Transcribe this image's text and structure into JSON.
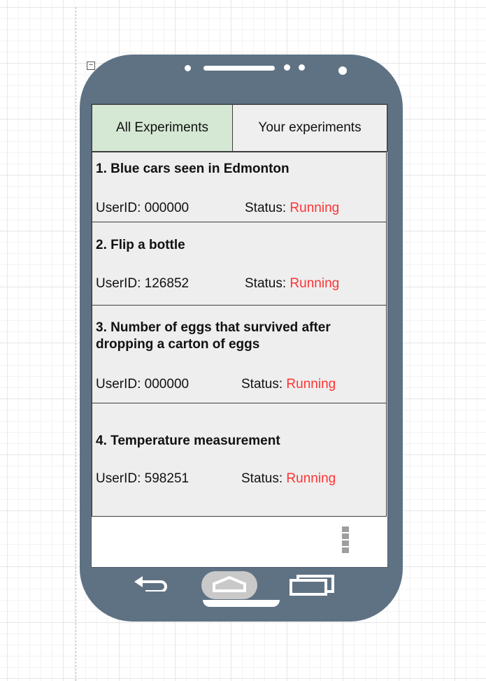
{
  "tabs": {
    "all_experiments": "All Experiments",
    "your_experiments": "Your experiments"
  },
  "experiments": [
    {
      "title": "1. Blue cars seen in Edmonton",
      "user_label": "UserID: 000000",
      "status_label": "Status: ",
      "status_value": "Running"
    },
    {
      "title": "2. Flip a bottle",
      "user_label": "UserID: 126852",
      "status_label": "Status: ",
      "status_value": "Running"
    },
    {
      "title": "3. Number of eggs that survived after dropping a carton of eggs",
      "user_label": "UserID: 000000",
      "status_label": "Status: ",
      "status_value": "Running"
    },
    {
      "title": "4. Temperature measurement",
      "user_label": "UserID: 598251",
      "status_label": "Status: ",
      "status_value": "Running"
    }
  ],
  "icons": {
    "overflow_menu": "vertical-dots-icon",
    "back": "back-arrow-icon",
    "home": "home-icon",
    "recent": "recent-apps-icon",
    "collapse": "collapse-icon"
  },
  "colors": {
    "phone_body": "#5f7284",
    "active_tab": "#d5e8d4",
    "inactive_tab": "#efefef",
    "card_background": "#eeeeee",
    "status_running": "#ff3333"
  }
}
